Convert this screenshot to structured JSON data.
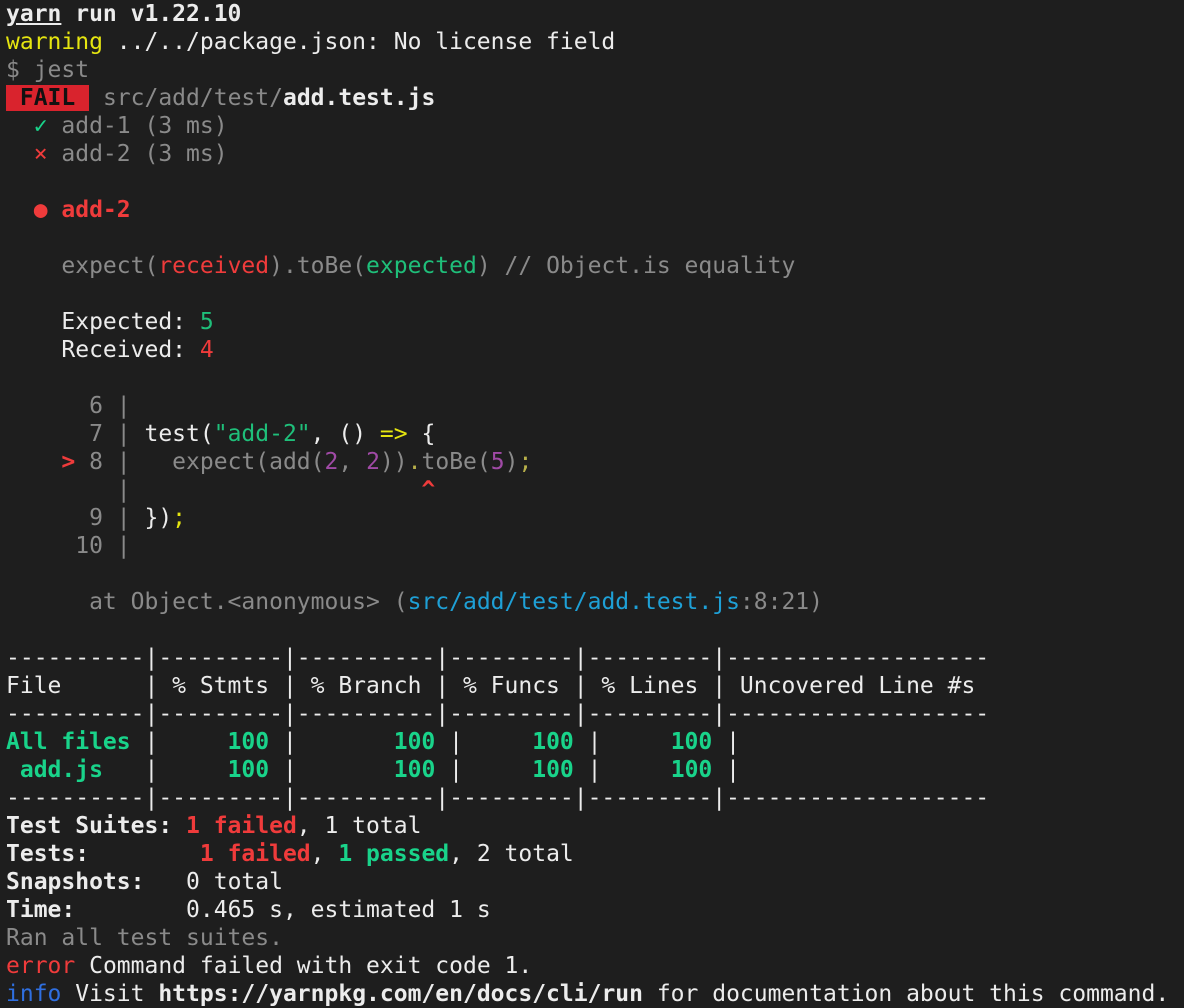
{
  "header": {
    "yarn_word": "yarn",
    "yarn_rest": " run v1.22.10",
    "warning_label": "warning",
    "warning_text": " ../../package.json: No license field",
    "command": "$ jest"
  },
  "suite": {
    "badge": " FAIL ",
    "path_dir": " src/add/test/",
    "path_file": "add.test.js",
    "tests": [
      {
        "mark": "  ✓ ",
        "text": "add-1 (3 ms)"
      },
      {
        "mark": "  × ",
        "text": "add-2 (3 ms)"
      }
    ]
  },
  "failure": {
    "bullet": "  ● ",
    "title": "add-2",
    "matcher": {
      "p1": "    expect(",
      "received": "received",
      "p2": ").toBe(",
      "expected": "expected",
      "p3": ")",
      "comment": " // Object.is equality"
    },
    "expected_label": "    Expected: ",
    "expected_value": "5",
    "received_label": "    Received: ",
    "received_value": "4"
  },
  "code": {
    "l6_num": "      6 |",
    "l7_num": "      7 |",
    "l7_a": " test(",
    "l7_str": "\"add-2\"",
    "l7_b": ", () ",
    "l7_arrow": "=>",
    "l7_c": " {",
    "l8_marker": "    > ",
    "l8_num": "8 |",
    "l8_a": "   expect(add(",
    "l8_n1": "2",
    "l8_comma": ", ",
    "l8_n2": "2",
    "l8_b": "))",
    "l8_dot": ".",
    "l8_c": "toBe(",
    "l8_n3": "5",
    "l8_d": ")",
    "l8_semi": ";",
    "caret_pipe": "        |",
    "caret_pad": "                     ",
    "caret": "^",
    "l9_num": "      9 |",
    "l9_a": " })",
    "l9_semi": ";",
    "l10_num": "     10 |",
    "at_prefix": "      at Object.<anonymous> (",
    "at_path": "src/add/test/add.test.js",
    "at_suffix": ":8:21)"
  },
  "coverage": {
    "sep": "----------|---------|----------|---------|---------|-------------------",
    "header_row": "File      | % Stmts | % Branch | % Funcs | % Lines | Uncovered Line #s ",
    "rows": [
      {
        "name": "All files",
        "pad": " | ",
        "stmts": "    100",
        "branch": "      100",
        "funcs": "    100",
        "lines": "    100"
      },
      {
        "name": " add.js",
        "pad": "   | ",
        "stmts": "    100",
        "branch": "      100",
        "funcs": "    100",
        "lines": "    100"
      }
    ],
    "pipe_mid": " | ",
    "pipe_end": " |"
  },
  "summary": {
    "suites_label": "Test Suites:",
    "suites_failed": " 1 failed",
    "suites_rest": ", 1 total",
    "tests_label": "Tests:",
    "tests_pad": "       ",
    "tests_failed": " 1 failed",
    "tests_sep": ", ",
    "tests_passed": "1 passed",
    "tests_rest": ", 2 total",
    "snap_label": "Snapshots:",
    "snap_value": "   0 total",
    "time_label": "Time:",
    "time_value": "        0.465 s, estimated 1 s",
    "ran": "Ran all test suites."
  },
  "footer": {
    "error_label": "error",
    "error_text": " Command failed with exit code 1.",
    "info_label": "info",
    "info_pre": " Visit ",
    "info_url": "https://yarnpkg.com/en/docs/cli/run",
    "info_post": " for documentation about this command."
  }
}
